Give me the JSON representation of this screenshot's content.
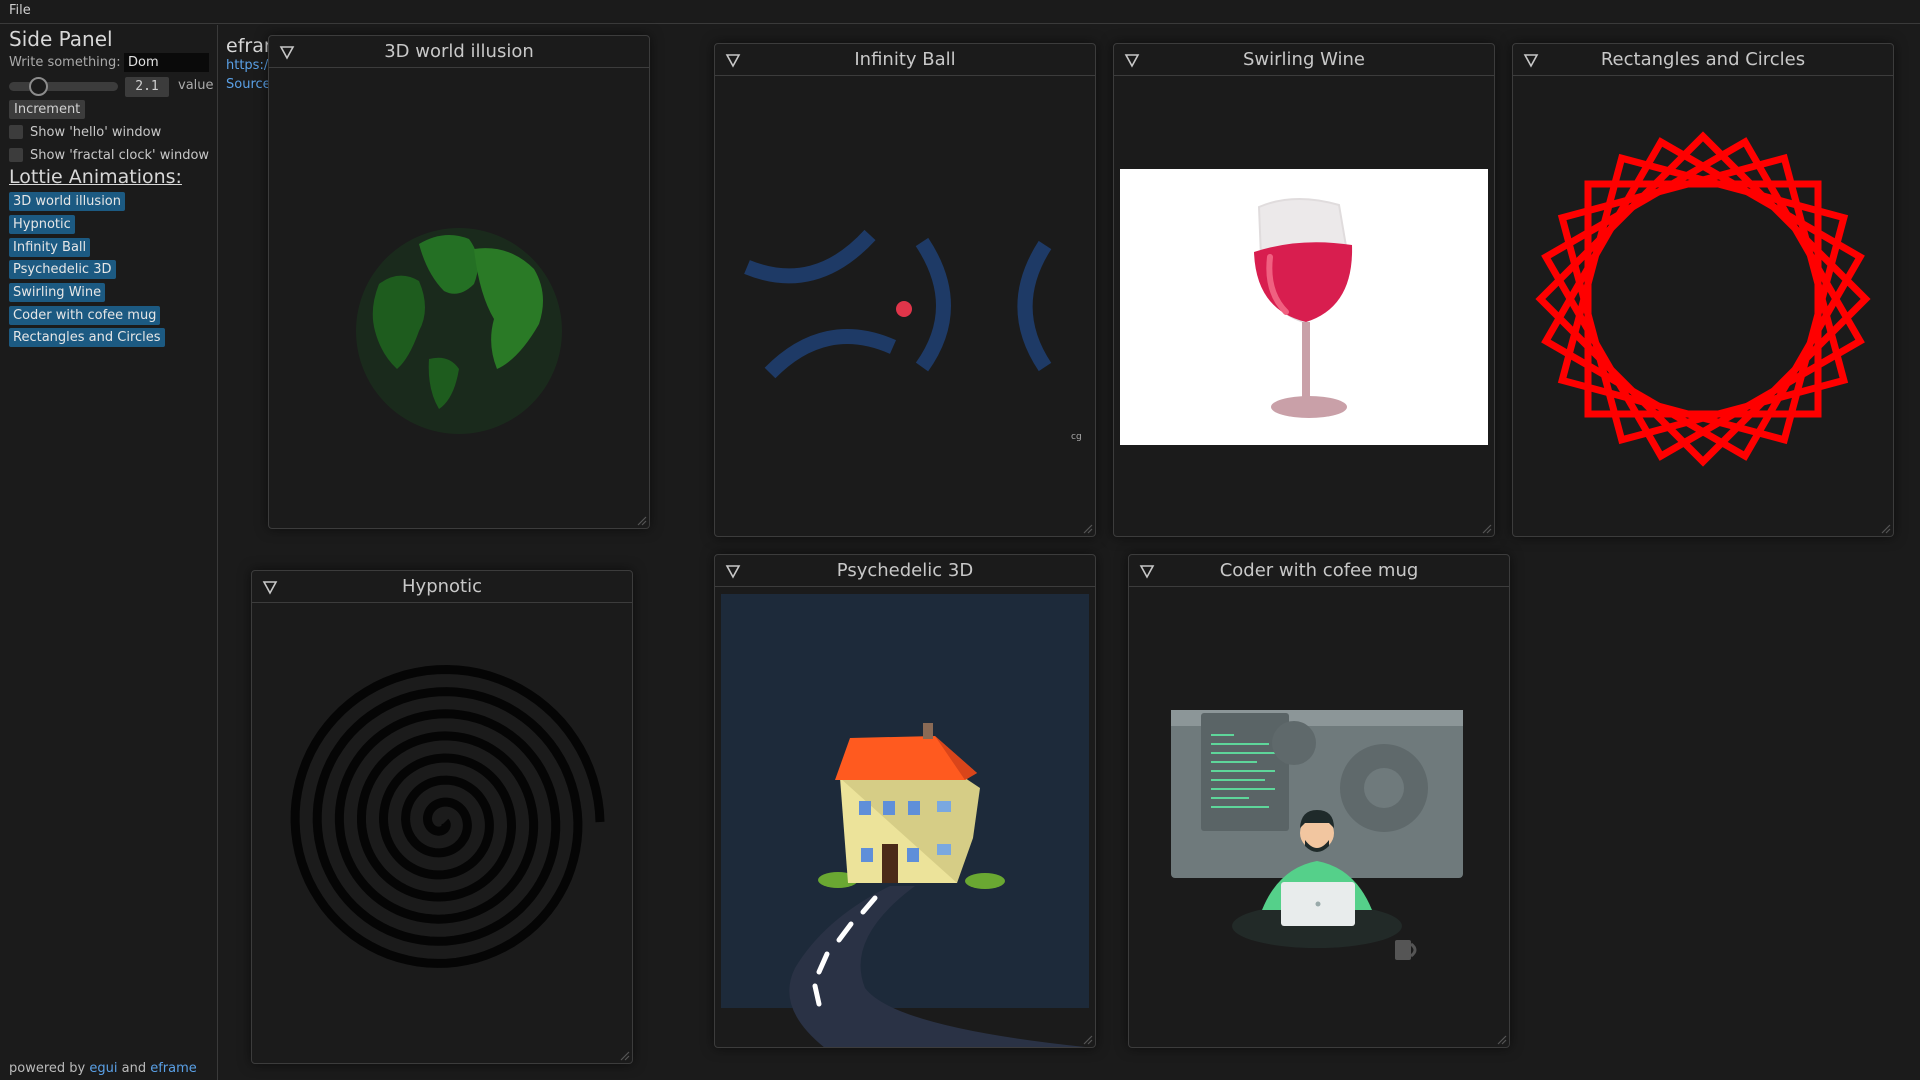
{
  "menu": {
    "file": "File"
  },
  "side_panel": {
    "heading": "Side Panel",
    "write_label": "Write something:",
    "write_value": "Dom",
    "slider_value": "2.1",
    "slider_fraction": 0.22,
    "slider_label": "value",
    "increment": "Increment",
    "show_hello": "Show 'hello' window",
    "show_clock": "Show 'fractal clock' window",
    "lottie_heading": "Lottie Animations:",
    "animations": [
      "3D world illusion",
      "Hypnotic",
      "Infinity Ball",
      "Psychedelic 3D",
      "Swirling Wine",
      "Coder with cofee mug",
      "Rectangles and Circles"
    ],
    "powered_prefix": "powered by",
    "powered_egui": "egui",
    "powered_and": "and",
    "powered_eframe": "eframe"
  },
  "central": {
    "title": "efran",
    "link": "https:/",
    "source": "Source"
  },
  "windows": {
    "world": {
      "title": "3D world illusion"
    },
    "hypnotic": {
      "title": "Hypnotic"
    },
    "infinity": {
      "title": "Infinity Ball",
      "watermark": "cg"
    },
    "psychedelic": {
      "title": "Psychedelic 3D"
    },
    "wine": {
      "title": "Swirling Wine"
    },
    "coder": {
      "title": "Coder with cofee mug"
    },
    "rects": {
      "title": "Rectangles and Circles"
    }
  },
  "colors": {
    "accent_button": "#1c5a82",
    "link": "#5aa0e6",
    "panel_bg": "#1b1b1b",
    "rect_red": "#ff0000",
    "wine_red": "#d81e4f",
    "infinity_blue": "#1e3a66"
  }
}
